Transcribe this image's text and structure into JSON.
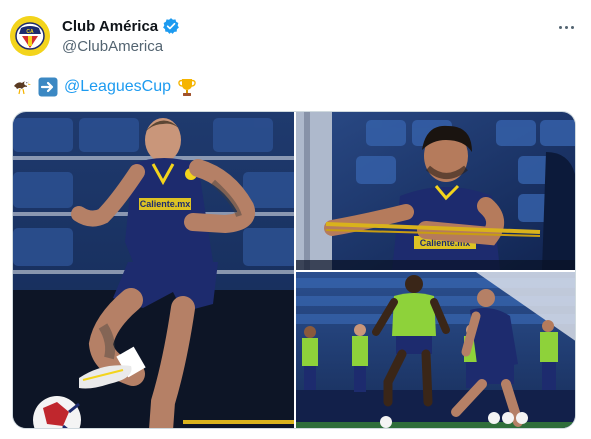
{
  "account": {
    "display_name": "Club América",
    "handle": "@ClubAmerica",
    "verified": true,
    "avatar_icon": "club-america-crest-icon"
  },
  "tweet": {
    "prefix_emoji": [
      "eagle-emoji-icon",
      "right-arrow-emoji-icon"
    ],
    "mention": "@LeaguesCup",
    "suffix_emoji": "trophy-emoji-icon"
  },
  "media": {
    "photos": [
      {
        "name": "photo-player-juggling-ball",
        "jersey_text": "Caliente.mx"
      },
      {
        "name": "photo-player-resistance-band",
        "jersey_text": "Caliente.mx"
      },
      {
        "name": "photo-team-training-session"
      }
    ]
  },
  "colors": {
    "accent": "#1d9bf0",
    "text": "#0f1419",
    "muted": "#536471",
    "america_yellow": "#f3d41c",
    "america_blue": "#1d2b6e",
    "stadium_seat": "#1f3a6e"
  }
}
